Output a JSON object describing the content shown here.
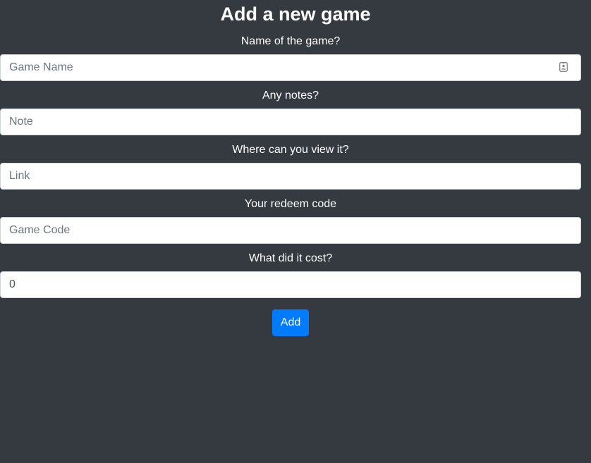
{
  "page": {
    "title": "Add a new game"
  },
  "form": {
    "fields": [
      {
        "label": "Name of the game?",
        "placeholder": "Game Name",
        "value": "",
        "icon": "contact-card-icon"
      },
      {
        "label": "Any notes?",
        "placeholder": "Note",
        "value": ""
      },
      {
        "label": "Where can you view it?",
        "placeholder": "Link",
        "value": ""
      },
      {
        "label": "Your redeem code",
        "placeholder": "Game Code",
        "value": ""
      },
      {
        "label": "What did it cost?",
        "placeholder": "",
        "value": "0"
      }
    ],
    "submit_label": "Add"
  },
  "colors": {
    "background": "#343a40",
    "accent": "#007bff"
  }
}
